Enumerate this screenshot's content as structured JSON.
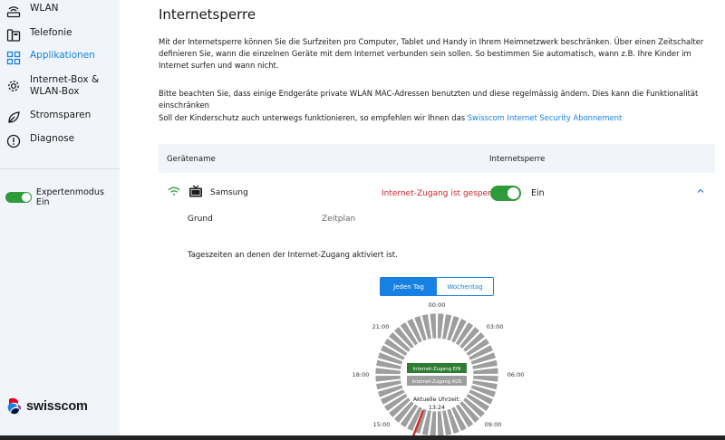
{
  "sidebar": {
    "items": [
      {
        "label": "WLAN",
        "icon": "router-icon"
      },
      {
        "label": "Telefonie",
        "icon": "phone-icon"
      },
      {
        "label": "Applikationen",
        "icon": "grid-icon",
        "active": true
      },
      {
        "label": "Internet-Box &\nWLAN-Box",
        "icon": "settings-icon"
      },
      {
        "label": "Stromsparen",
        "icon": "leaf-icon"
      },
      {
        "label": "Diagnose",
        "icon": "alert-icon"
      }
    ],
    "expert_label": "Expertenmodus Ein",
    "logo_text": "swisscom"
  },
  "main": {
    "title": "Internetsperre",
    "intro": "Mit der Internetsperre können Sie die Surfzeiten pro Computer, Tablet und Handy in Ihrem Heimnetzwerk beschränken. Über einen Zeitschalter definieren Sie, wann die einzelnen Geräte mit dem Internet verbunden sein sollen. So bestimmen Sie automatisch, wann z.B. Ihre Kinder im Internet surfen und wann nicht.",
    "note": "Bitte beachten Sie, dass einige Endgeräte private WLAN MAC-Adressen benutzten und diese regelmässig ändern. Dies kann die Funktionalität einschränken",
    "link_prefix": "Soll der Kinderschutz auch unterwegs funktionieren, so empfehlen wir Ihnen das ",
    "link_text": "Swisscom Internet Security Abonnement"
  },
  "table": {
    "col_device": "Gerätename",
    "col_block": "Internetsperre",
    "row": {
      "device": "Samsung",
      "status": "Internet-Zugang ist gesperrt",
      "toggle_label": "Ein",
      "reason_label": "Grund",
      "reason_value": "Zeitplan"
    }
  },
  "schedule": {
    "heading": "Tageszeiten an denen der Internet-Zugang aktiviert ist.",
    "tab_day": "Jeden Tag",
    "tab_week": "Wochentag",
    "hours": [
      "00:00",
      "03:00",
      "06:00",
      "09:00",
      "15:00",
      "18:00",
      "21:00"
    ],
    "legend_on": "Internet-Zugang EIN",
    "legend_off": "Internet-Zugang AUS",
    "current_label": "Aktuelle Uhrzeit:",
    "current_time": "13:24",
    "segments": 48,
    "color_on": "#2e7d32",
    "color_off": "#9e9e9e"
  },
  "colors": {
    "accent": "#1781e3",
    "toggle_on": "#2f9a3a",
    "blocked_text": "#c7262c"
  }
}
